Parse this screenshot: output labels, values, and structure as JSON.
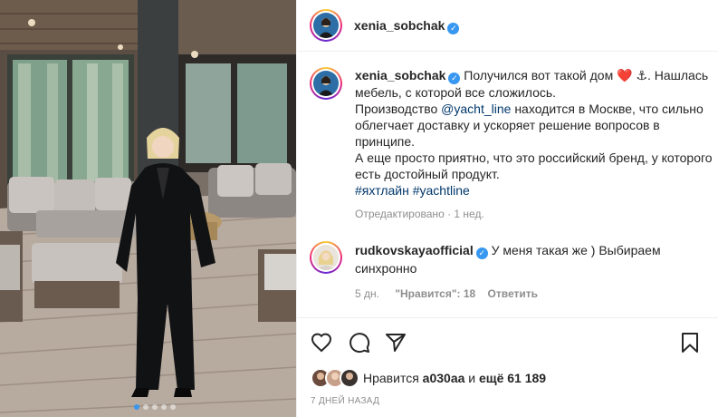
{
  "post": {
    "photo_alt": "",
    "carousel": {
      "count": 5,
      "active": 0
    }
  },
  "header": {
    "username": "xenia_sobchak",
    "verified_icon": "check-badge-icon"
  },
  "caption": {
    "username": "xenia_sobchak",
    "line1": "Получился вот такой дом ❤️ ⚓. Нашлась мебель, с которой все сложилось.",
    "line2_prefix": "Производство ",
    "mention": "@yacht_line",
    "line2_suffix": " находится в Москве, что сильно облегчает доставку и ускоряет решение вопросов в принципе.",
    "line3": "А еще просто приятно, что это российский бренд, у которого есть достойный продукт.",
    "hashtag1": "#яхтлайн",
    "hashtag2": "#yachtline",
    "meta": "Отредактировано · 1 нед."
  },
  "comment": {
    "username": "rudkovskayaofficial",
    "text": "У меня такая же ) Выбираем синхронно",
    "time": "5 дн.",
    "likes": "\"Нравится\": 18",
    "reply": "Ответить"
  },
  "likes": {
    "prefix": "Нравится ",
    "user": "a030aa",
    "middle": " и ",
    "others": "ещё 61 189"
  },
  "date": "7 ДНЕЙ НАЗАД",
  "colors": {
    "verified": "#3897f0",
    "link": "#00376b",
    "muted": "#8e8e8e",
    "text": "#262626"
  }
}
